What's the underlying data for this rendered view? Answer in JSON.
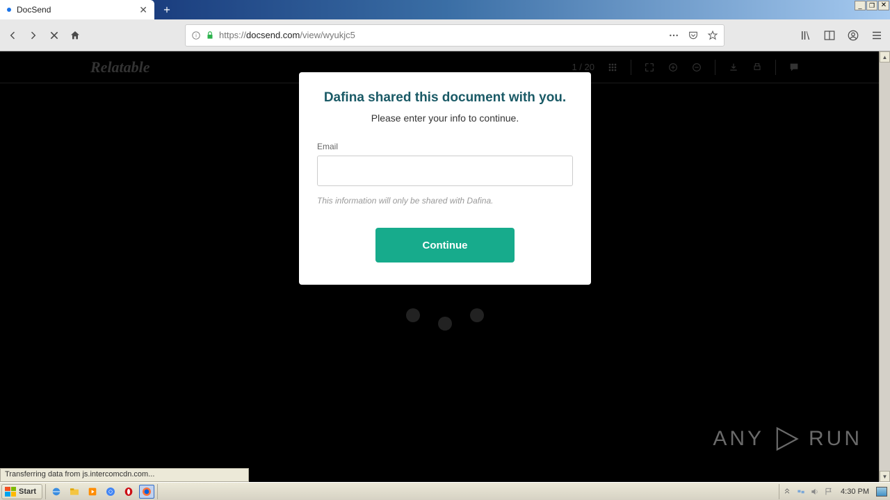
{
  "tab": {
    "title": "DocSend"
  },
  "url": {
    "prefix": "https://",
    "domain": "docsend.com",
    "path": "/view/wyukjc5"
  },
  "viewer": {
    "brand": "Relatable",
    "page_indicator": "1 / 20"
  },
  "modal": {
    "title": "Dafina shared this document with you.",
    "subtitle": "Please enter your info to continue.",
    "email_label": "Email",
    "email_value": "",
    "note": "This information will only be shared with Dafina.",
    "continue_label": "Continue"
  },
  "watermark": {
    "left": "ANY",
    "right": "RUN"
  },
  "status": "Transferring data from js.intercomcdn.com...",
  "taskbar": {
    "start_label": "Start",
    "clock": "4:30 PM"
  }
}
